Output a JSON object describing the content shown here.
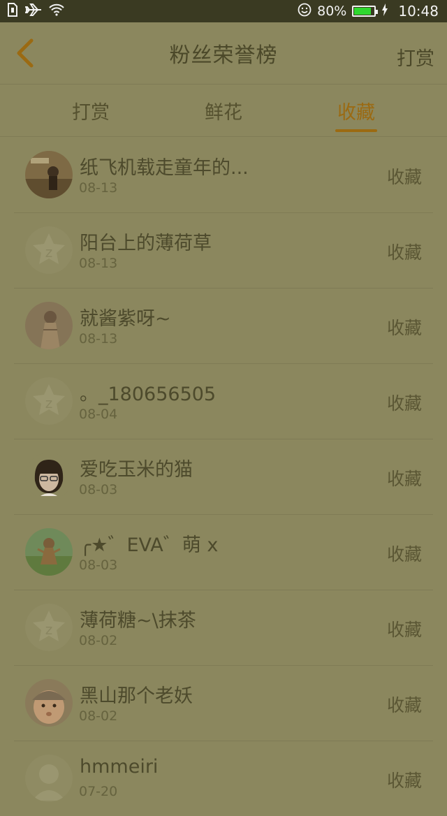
{
  "status_bar": {
    "battery": "80%",
    "time": "10:48",
    "battery_level": 0.8,
    "battery_color": "#2fd82f"
  },
  "header": {
    "title": "粉丝荣誉榜",
    "action": "打赏"
  },
  "tabs": [
    {
      "label": "打赏"
    },
    {
      "label": "鲜花"
    },
    {
      "label": "收藏"
    }
  ],
  "rows": [
    {
      "name": "纸飞机载走童年的...",
      "date": "08-13",
      "action": "收藏",
      "avatar_icon": "photo-avatar-icon"
    },
    {
      "name": "阳台上的薄荷草",
      "date": "08-13",
      "action": "收藏",
      "avatar_icon": "default-avatar-icon"
    },
    {
      "name": "就酱紫呀~",
      "date": "08-13",
      "action": "收藏",
      "avatar_icon": "photo-avatar-icon"
    },
    {
      "name": "。_180656505",
      "date": "08-04",
      "action": "收藏",
      "avatar_icon": "default-avatar-icon"
    },
    {
      "name": "爱吃玉米的猫",
      "date": "08-03",
      "action": "收藏",
      "avatar_icon": "cartoon-girl-avatar-icon"
    },
    {
      "name": "╭★゛EVA゛萌 x",
      "date": "08-03",
      "action": "收藏",
      "avatar_icon": "photo-avatar-icon"
    },
    {
      "name": "薄荷糖~\\抹茶",
      "date": "08-02",
      "action": "收藏",
      "avatar_icon": "default-avatar-icon"
    },
    {
      "name": "黑山那个老妖",
      "date": "08-02",
      "action": "收藏",
      "avatar_icon": "baby-photo-avatar-icon"
    },
    {
      "name": "hmmeiri",
      "date": "07-20",
      "action": "收藏",
      "avatar_icon": "default-avatar-icon"
    }
  ]
}
